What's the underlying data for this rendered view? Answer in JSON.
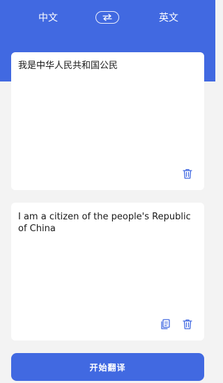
{
  "header": {
    "source_language": "中文",
    "target_language": "英文",
    "swap_icon": "swap-arrows-icon"
  },
  "input": {
    "text": "我是中华人民共和国公民",
    "delete_icon": "trash-icon"
  },
  "output": {
    "text": "I am a citizen of the people's Republic of China",
    "copy_icon": "copy-icon",
    "delete_icon": "trash-icon"
  },
  "actions": {
    "translate_label": "开始翻译"
  },
  "colors": {
    "accent": "#4169e1",
    "background": "#f3f3f3",
    "card": "#ffffff"
  }
}
